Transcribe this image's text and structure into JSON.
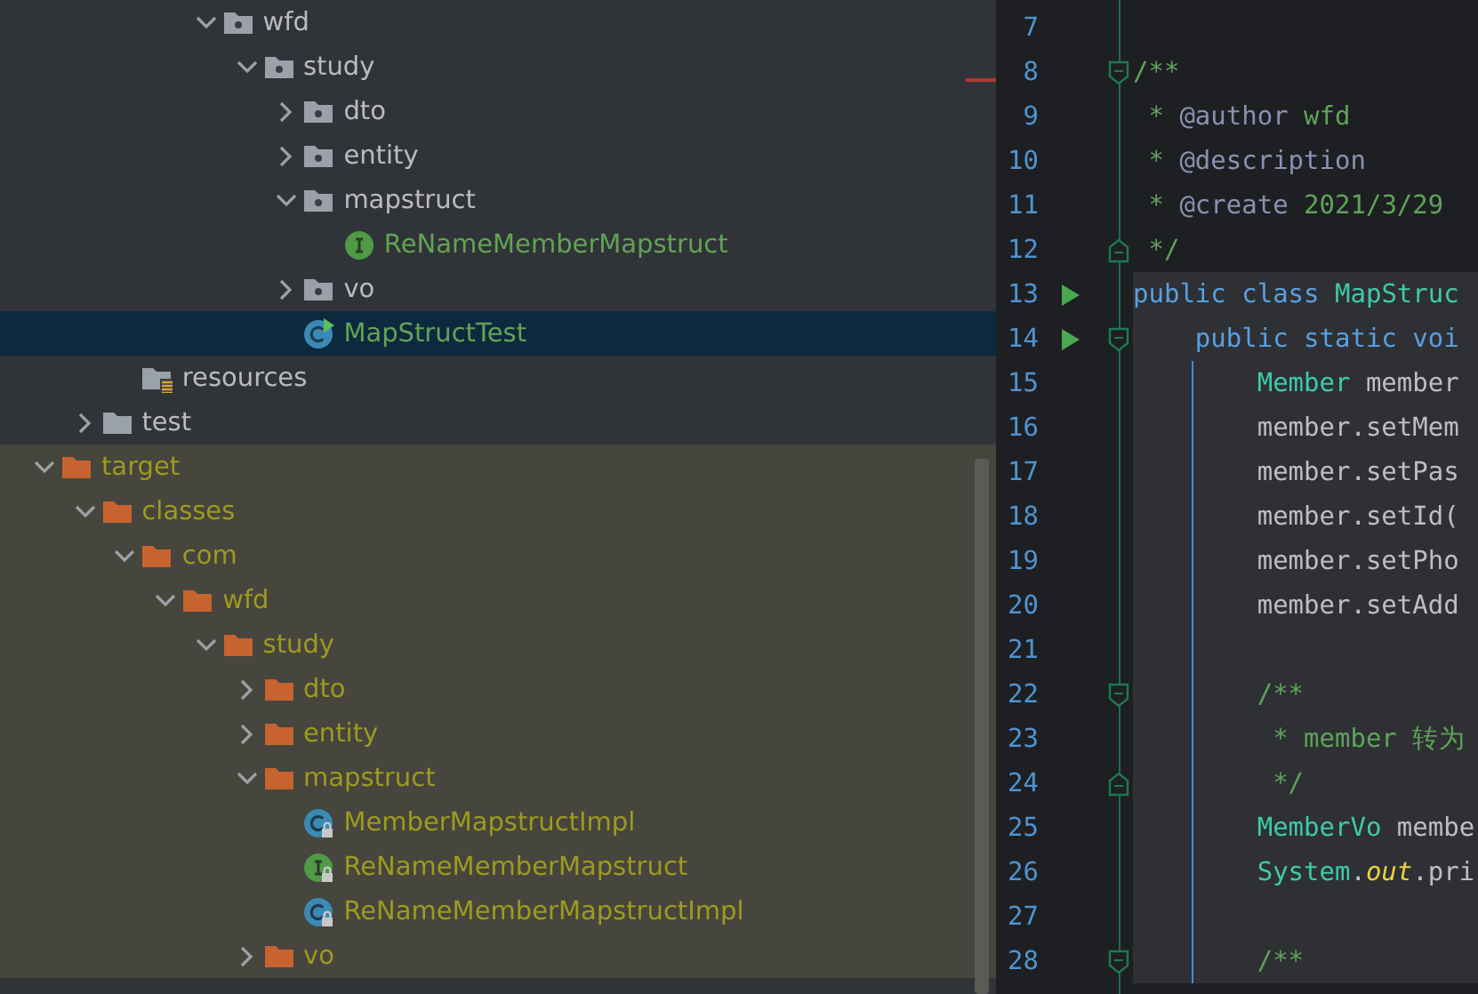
{
  "project_tree": {
    "nodes": [
      {
        "children": [
          {
            "children": [
              {
                "children": [
                  {
                    "children": [
                      {
                        "label": "wfd",
                        "kind": "package",
                        "expanded": true,
                        "selected": false,
                        "color": "#bbbbbb",
                        "children": [
                          {
                            "label": "study",
                            "kind": "package",
                            "expanded": true,
                            "selected": false,
                            "color": "#bbbbbb",
                            "children": [
                              {
                                "label": "dto",
                                "kind": "package",
                                "expanded": false,
                                "selected": false,
                                "color": "#bbbbbb"
                              },
                              {
                                "label": "entity",
                                "kind": "package",
                                "expanded": false,
                                "selected": false,
                                "color": "#bbbbbb"
                              },
                              {
                                "label": "mapstruct",
                                "kind": "package",
                                "expanded": true,
                                "selected": false,
                                "color": "#bbbbbb",
                                "children": [
                                  {
                                    "label": "ReNameMemberMapstruct",
                                    "kind": "interface",
                                    "selected": false,
                                    "color": "#62a355",
                                    "locked": false
                                  }
                                ]
                              },
                              {
                                "label": "vo",
                                "kind": "package",
                                "expanded": false,
                                "selected": false,
                                "color": "#bbbbbb"
                              },
                              {
                                "label": "MapStructTest",
                                "kind": "test-class",
                                "selected": true,
                                "color": "#62a355",
                                "locked": false
                              }
                            ]
                          }
                        ]
                      }
                    ]
                  }
                ]
              },
              {
                "label": "resources",
                "kind": "resources",
                "selected": false,
                "color": "#bbbbbb"
              }
            ]
          },
          {
            "label": "test",
            "kind": "folder",
            "expanded": false,
            "selected": false,
            "color": "#bbbbbb"
          }
        ]
      },
      {
        "label": "target",
        "kind": "folder",
        "expanded": true,
        "excluded": true,
        "selected": false,
        "color": "#9e9a1e",
        "children": [
          {
            "label": "classes",
            "kind": "folder",
            "expanded": true,
            "selected": false,
            "color": "#9e9a1e",
            "children": [
              {
                "label": "com",
                "kind": "folder",
                "expanded": true,
                "selected": false,
                "color": "#9e9a1e",
                "children": [
                  {
                    "label": "wfd",
                    "kind": "folder",
                    "expanded": true,
                    "selected": false,
                    "color": "#9e9a1e",
                    "children": [
                      {
                        "label": "study",
                        "kind": "folder",
                        "expanded": true,
                        "selected": false,
                        "color": "#9e9a1e",
                        "children": [
                          {
                            "label": "dto",
                            "kind": "folder",
                            "expanded": false,
                            "selected": false,
                            "color": "#9e9a1e"
                          },
                          {
                            "label": "entity",
                            "kind": "folder",
                            "expanded": false,
                            "selected": false,
                            "color": "#9e9a1e"
                          },
                          {
                            "label": "mapstruct",
                            "kind": "folder",
                            "expanded": true,
                            "selected": false,
                            "color": "#9e9a1e",
                            "children": [
                              {
                                "label": "MemberMapstructImpl",
                                "kind": "class",
                                "selected": false,
                                "color": "#9e9a1e",
                                "locked": true
                              },
                              {
                                "label": "ReNameMemberMapstruct",
                                "kind": "interface",
                                "selected": false,
                                "color": "#9e9a1e",
                                "locked": true
                              },
                              {
                                "label": "ReNameMemberMapstructImpl",
                                "kind": "class",
                                "selected": false,
                                "color": "#9e9a1e",
                                "locked": true
                              }
                            ]
                          },
                          {
                            "label": "vo",
                            "kind": "folder",
                            "expanded": false,
                            "selected": false,
                            "color": "#9e9a1e"
                          }
                        ]
                      }
                    ]
                  }
                ]
              }
            ]
          }
        ]
      }
    ]
  },
  "editor": {
    "lines": [
      {
        "number": "7",
        "run": false,
        "fold_start": false,
        "fold_end": false,
        "scope": false,
        "guide": false
      },
      {
        "number": "8",
        "run": false,
        "fold_start": true,
        "fold_end": false,
        "scope": false,
        "guide": false,
        "tokens": [
          {
            "text": "/**",
            "kind": "doc"
          }
        ]
      },
      {
        "number": "9",
        "run": false,
        "fold_start": false,
        "fold_end": false,
        "scope": false,
        "guide": false,
        "tokens": [
          {
            "text": " * ",
            "kind": "doc"
          },
          {
            "text": "@author",
            "kind": "doc-tag"
          },
          {
            "text": " wfd",
            "kind": "doc"
          }
        ]
      },
      {
        "number": "10",
        "run": false,
        "fold_start": false,
        "fold_end": false,
        "scope": false,
        "guide": false,
        "tokens": [
          {
            "text": " * ",
            "kind": "doc"
          },
          {
            "text": "@description",
            "kind": "doc-tag"
          }
        ]
      },
      {
        "number": "11",
        "run": false,
        "fold_start": false,
        "fold_end": false,
        "scope": false,
        "guide": false,
        "tokens": [
          {
            "text": " * ",
            "kind": "doc"
          },
          {
            "text": "@create",
            "kind": "doc-tag"
          },
          {
            "text": " 2021/3/29",
            "kind": "doc"
          }
        ]
      },
      {
        "number": "12",
        "run": false,
        "fold_start": false,
        "fold_end": true,
        "scope": false,
        "guide": false,
        "tokens": [
          {
            "text": " */",
            "kind": "doc"
          }
        ]
      },
      {
        "number": "13",
        "run": true,
        "fold_start": false,
        "fold_end": false,
        "scope": true,
        "guide": false,
        "tokens": [
          {
            "text": "public class ",
            "kind": "keyword"
          },
          {
            "text": "MapStruc",
            "kind": "type"
          }
        ]
      },
      {
        "number": "14",
        "run": true,
        "fold_start": true,
        "fold_end": false,
        "scope": true,
        "guide": false,
        "tokens": [
          {
            "text": "    public static voi",
            "kind": "keyword"
          }
        ]
      },
      {
        "number": "15",
        "run": false,
        "fold_start": false,
        "fold_end": false,
        "scope": true,
        "guide": true,
        "tokens": [
          {
            "text": "        Member",
            "kind": "type"
          },
          {
            "text": " member",
            "kind": "plain"
          }
        ]
      },
      {
        "number": "16",
        "run": false,
        "fold_start": false,
        "fold_end": false,
        "scope": true,
        "guide": true,
        "tokens": [
          {
            "text": "        member.setMem",
            "kind": "plain"
          }
        ]
      },
      {
        "number": "17",
        "run": false,
        "fold_start": false,
        "fold_end": false,
        "scope": true,
        "guide": true,
        "tokens": [
          {
            "text": "        member.setPas",
            "kind": "plain"
          }
        ]
      },
      {
        "number": "18",
        "run": false,
        "fold_start": false,
        "fold_end": false,
        "scope": true,
        "guide": true,
        "tokens": [
          {
            "text": "        member.setId(",
            "kind": "plain"
          }
        ]
      },
      {
        "number": "19",
        "run": false,
        "fold_start": false,
        "fold_end": false,
        "scope": true,
        "guide": true,
        "tokens": [
          {
            "text": "        member.setPho",
            "kind": "plain"
          }
        ]
      },
      {
        "number": "20",
        "run": false,
        "fold_start": false,
        "fold_end": false,
        "scope": true,
        "guide": true,
        "tokens": [
          {
            "text": "        member.setAdd",
            "kind": "plain"
          }
        ]
      },
      {
        "number": "21",
        "run": false,
        "fold_start": false,
        "fold_end": false,
        "scope": true,
        "guide": true
      },
      {
        "number": "22",
        "run": false,
        "fold_start": true,
        "fold_end": false,
        "scope": true,
        "guide": true,
        "tokens": [
          {
            "text": "        /**",
            "kind": "comment"
          }
        ]
      },
      {
        "number": "23",
        "run": false,
        "fold_start": false,
        "fold_end": false,
        "scope": true,
        "guide": true,
        "tokens": [
          {
            "text": "         * member 转为",
            "kind": "comment"
          }
        ]
      },
      {
        "number": "24",
        "run": false,
        "fold_start": false,
        "fold_end": true,
        "scope": true,
        "guide": true,
        "tokens": [
          {
            "text": "         */",
            "kind": "comment"
          }
        ]
      },
      {
        "number": "25",
        "run": false,
        "fold_start": false,
        "fold_end": false,
        "scope": true,
        "guide": true,
        "tokens": [
          {
            "text": "        MemberVo",
            "kind": "type"
          },
          {
            "text": " membe",
            "kind": "plain"
          }
        ]
      },
      {
        "number": "26",
        "run": false,
        "fold_start": false,
        "fold_end": false,
        "scope": true,
        "guide": true,
        "tokens": [
          {
            "text": "        System",
            "kind": "type"
          },
          {
            "text": ".",
            "kind": "plain"
          },
          {
            "text": "out",
            "kind": "field"
          },
          {
            "text": ".pri",
            "kind": "plain"
          }
        ]
      },
      {
        "number": "27",
        "run": false,
        "fold_start": false,
        "fold_end": false,
        "scope": true,
        "guide": true
      },
      {
        "number": "28",
        "run": false,
        "fold_start": true,
        "fold_end": false,
        "scope": true,
        "guide": true,
        "tokens": [
          {
            "text": "        /**",
            "kind": "comment"
          }
        ]
      }
    ]
  }
}
